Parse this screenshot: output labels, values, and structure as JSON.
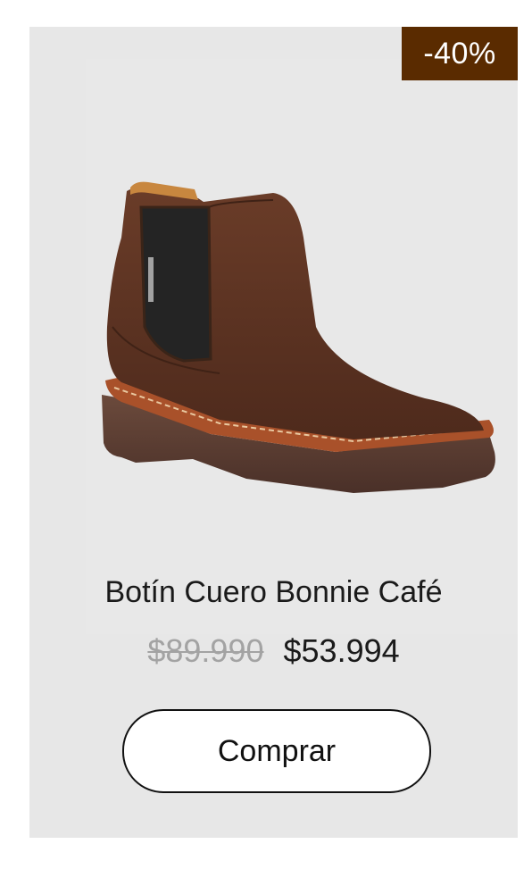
{
  "product": {
    "discount_badge": "-40%",
    "name": "Botín Cuero Bonnie Café",
    "original_price": "$89.990",
    "sale_price": "$53.994",
    "image_alt": "boot-photo"
  },
  "actions": {
    "buy_label": "Comprar"
  },
  "colors": {
    "card_background": "#e7e7e7",
    "badge_background": "#5a2b00",
    "boot_suede": "#5b3322",
    "boot_sole": "#5e4033"
  }
}
